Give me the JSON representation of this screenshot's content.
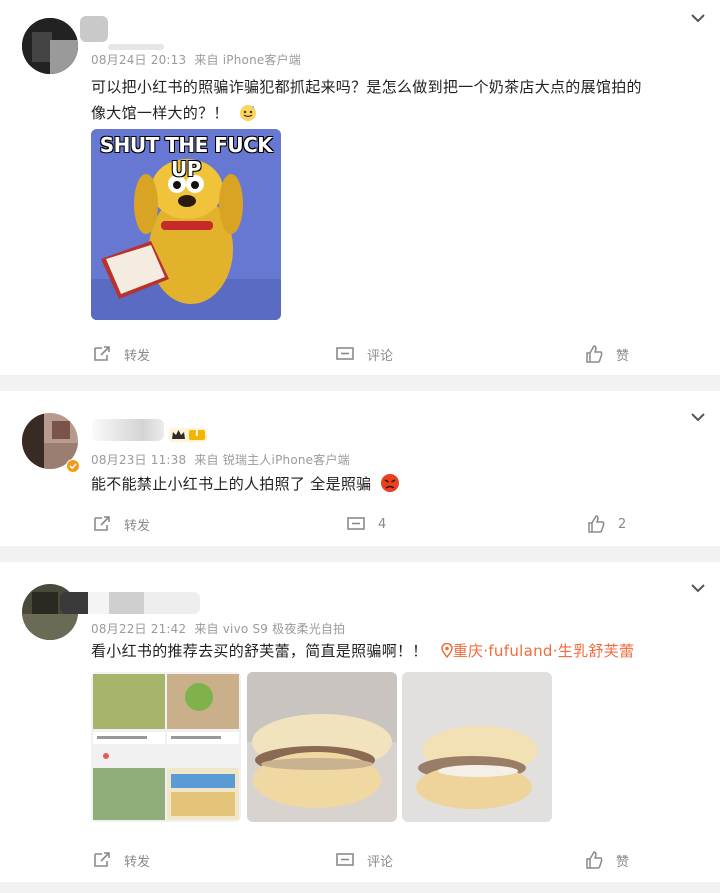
{
  "posts": [
    {
      "timestamp": "08月24日 20:13",
      "source": "来自 iPhone客户端",
      "text_line1": "可以把小红书的照骗诈骗犯都抓起来吗？是怎么做到把一个奶茶店大点的展馆拍的",
      "text_line2": "像大馆一样大的？！",
      "meme_caption": "SHUT THE FUCK UP",
      "repost_label": "转发",
      "comment_label": "评论",
      "like_label": "赞",
      "emoji_icon": "sweat-smile-emoji"
    },
    {
      "timestamp": "08月23日 11:38",
      "source": "来自 锐瑞主人iPhone客户端",
      "text": "能不能禁止小红书上的人拍照了 全是照骗",
      "badge_level": "I",
      "repost_label": "转发",
      "comment_count": "4",
      "like_count": "2",
      "emoji_icon": "angry-face-emoji"
    },
    {
      "timestamp": "08月22日 21:42",
      "source": "来自 vivo S9 极夜柔光自拍",
      "text": "看小红书的推荐去买的舒芙蕾，简直是照骗啊！！",
      "location": "重庆·fufuland·生乳舒芙蕾",
      "repost_label": "转发",
      "comment_label": "评论",
      "like_label": "赞"
    }
  ],
  "colors": {
    "accent_location": "#f26a3d",
    "meta_gray": "#9a9a9a",
    "vip_gold": "#f5b400"
  }
}
